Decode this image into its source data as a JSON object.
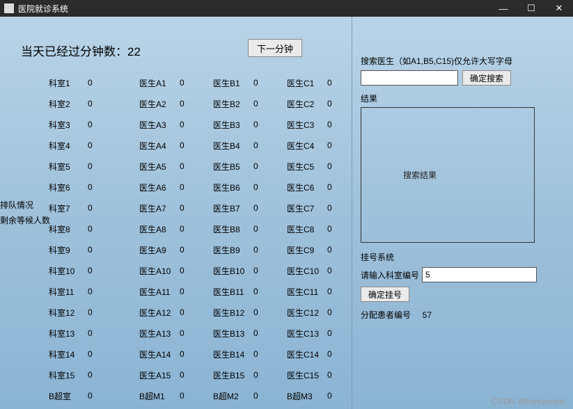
{
  "window": {
    "title": "医院就诊系统",
    "minimize": "—",
    "maximize": "☐",
    "close": "✕"
  },
  "minute": {
    "label_prefix": "当天已经过分钟数：",
    "value": "22",
    "next_btn": "下一分钟"
  },
  "side": {
    "line1": "排队情况",
    "line2": "剩余等候人数"
  },
  "rows": [
    {
      "room": "科室1",
      "rv": "0",
      "da": "医生A1",
      "dav": "0",
      "db": "医生B1",
      "dbv": "0",
      "dc": "医生C1",
      "dcv": "0"
    },
    {
      "room": "科室2",
      "rv": "0",
      "da": "医生A2",
      "dav": "0",
      "db": "医生B2",
      "dbv": "0",
      "dc": "医生C2",
      "dcv": "0"
    },
    {
      "room": "科室3",
      "rv": "0",
      "da": "医生A3",
      "dav": "0",
      "db": "医生B3",
      "dbv": "0",
      "dc": "医生C3",
      "dcv": "0"
    },
    {
      "room": "科室4",
      "rv": "0",
      "da": "医生A4",
      "dav": "0",
      "db": "医生B4",
      "dbv": "0",
      "dc": "医生C4",
      "dcv": "0"
    },
    {
      "room": "科室5",
      "rv": "0",
      "da": "医生A5",
      "dav": "0",
      "db": "医生B5",
      "dbv": "0",
      "dc": "医生C5",
      "dcv": "0"
    },
    {
      "room": "科室6",
      "rv": "0",
      "da": "医生A6",
      "dav": "0",
      "db": "医生B6",
      "dbv": "0",
      "dc": "医生C6",
      "dcv": "0"
    },
    {
      "room": "科室7",
      "rv": "0",
      "da": "医生A7",
      "dav": "0",
      "db": "医生B7",
      "dbv": "0",
      "dc": "医生C7",
      "dcv": "0"
    },
    {
      "room": "科室8",
      "rv": "0",
      "da": "医生A8",
      "dav": "0",
      "db": "医生B8",
      "dbv": "0",
      "dc": "医生C8",
      "dcv": "0"
    },
    {
      "room": "科室9",
      "rv": "0",
      "da": "医生A9",
      "dav": "0",
      "db": "医生B9",
      "dbv": "0",
      "dc": "医生C9",
      "dcv": "0"
    },
    {
      "room": "科室10",
      "rv": "0",
      "da": "医生A10",
      "dav": "0",
      "db": "医生B10",
      "dbv": "0",
      "dc": "医生C10",
      "dcv": "0"
    },
    {
      "room": "科室11",
      "rv": "0",
      "da": "医生A11",
      "dav": "0",
      "db": "医生B11",
      "dbv": "0",
      "dc": "医生C11",
      "dcv": "0"
    },
    {
      "room": "科室12",
      "rv": "0",
      "da": "医生A12",
      "dav": "0",
      "db": "医生B12",
      "dbv": "0",
      "dc": "医生C12",
      "dcv": "0"
    },
    {
      "room": "科室13",
      "rv": "0",
      "da": "医生A13",
      "dav": "0",
      "db": "医生B13",
      "dbv": "0",
      "dc": "医生C13",
      "dcv": "0"
    },
    {
      "room": "科室14",
      "rv": "0",
      "da": "医生A14",
      "dav": "0",
      "db": "医生B14",
      "dbv": "0",
      "dc": "医生C14",
      "dcv": "0"
    },
    {
      "room": "科室15",
      "rv": "0",
      "da": "医生A15",
      "dav": "0",
      "db": "医生B15",
      "dbv": "0",
      "dc": "医生C15",
      "dcv": "0"
    },
    {
      "room": "B超室",
      "rv": "0",
      "da": "B超M1",
      "dav": "0",
      "db": "B超M2",
      "dbv": "0",
      "dc": "B超M3",
      "dcv": "0"
    }
  ],
  "search": {
    "label": "搜索医生（如A1,B5,C15)仅允许大写字母",
    "btn": "确定搜索",
    "input_value": "",
    "result_label": "结果",
    "result_placeholder": "搜索结果"
  },
  "register": {
    "system_label": "挂号系统",
    "hint": "请输入科室编号",
    "input_value": "5",
    "btn": "确定挂号",
    "assign_label": "分配患者编号",
    "assign_value": "57"
  },
  "watermark": "CSDN @biyezuopin"
}
